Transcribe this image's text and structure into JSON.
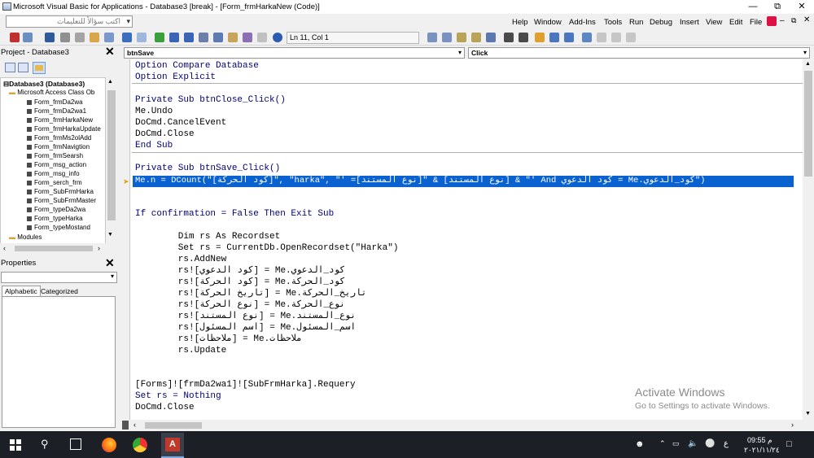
{
  "window": {
    "title": "Microsoft Visual Basic for Applications - Database3 [break] - [Form_frmHarkaNew (Code)]",
    "ask_placeholder": "اكتب سؤالاً للتعليمات"
  },
  "menu": [
    "Help",
    "Window",
    "Add-Ins",
    "Tools",
    "Run",
    "Debug",
    "Insert",
    "View",
    "Edit",
    "File"
  ],
  "toolbar": {
    "position": "Ln 11, Col 1"
  },
  "project": {
    "title": "Project - Database3",
    "root": "Database3 (Database3)",
    "folder": "Microsoft Access Class Ob",
    "items": [
      "Form_frmDa2wa",
      "Form_frmDa2wa1",
      "Form_frmHarkaNew",
      "Form_frmHarkaUpdate",
      "Form_frmMs2olAdd",
      "Form_frmNavigtion",
      "Form_frmSearsh",
      "Form_msg_action",
      "Form_msg_info",
      "Form_serch_frm",
      "Form_SubFrmHarka",
      "Form_SubFrmMaster",
      "Form_typeDa2wa",
      "Form_typeHarka",
      "Form_typeMostand"
    ],
    "modules": "Modules"
  },
  "properties": {
    "title": "Properties",
    "tab_alpha": "Alphabetic",
    "tab_cat": "Categorized"
  },
  "code": {
    "object": "btnSave",
    "procedure": "Click",
    "lines": [
      "Option Compare Database",
      "Option Explicit",
      "",
      "Private Sub btnClose_Click()",
      "Me.Undo",
      "DoCmd.CancelEvent",
      "DoCmd.Close",
      "End Sub",
      "",
      "Private Sub btnSave_Click()",
      "Me.n = DCount(\"[كود الحركة]\", \"harka\", \"' =[نوع المستند]\" & [نوع المستند] & \"' And كود الدعوي = Me.كود_الدعوي\")",
      "",
      "",
      "If confirmation = False Then Exit Sub",
      "",
      "        Dim rs As Recordset",
      "        Set rs = CurrentDb.OpenRecordset(\"Harka\")",
      "        rs.AddNew",
      "        rs![كود الدعوي] = Me.كود_الدعوي",
      "        rs![كود الحركة] = Me.كود_الحركة",
      "        rs![تاريخ الحركة] = Me.تاريخ_الحركة",
      "        rs![نوع الحركة] = Me.نوع_الحركة",
      "        rs![نوع المستند] = Me.نوع_المستند",
      "        rs![اسم المسئول] = Me.اسم_المسئول",
      "        rs![ملاحظات] = Me.ملاحظات",
      "        rs.Update",
      "",
      "",
      "[Forms]![frmDa2wa1]![SubFrmHarka].Requery",
      "Set rs = Nothing",
      "DoCmd.Close"
    ]
  },
  "watermark": {
    "line1": "Activate Windows",
    "line2": "Go to Settings to activate Windows."
  },
  "taskbar": {
    "time": "09:55 م",
    "date": "٢٠٢١/١١/٢٤",
    "lang": "ع"
  }
}
